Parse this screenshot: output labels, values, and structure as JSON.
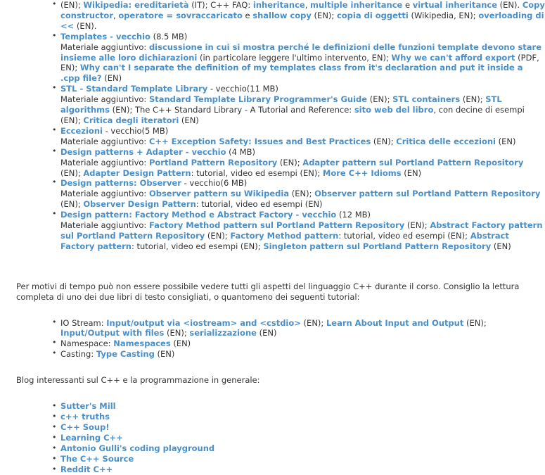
{
  "colors": {
    "link": "#4a8fc7",
    "text": "#333333",
    "background": "#ffffff"
  },
  "sections": {
    "materials_list": {
      "continued_first_entry": {
        "line_prefix": "(EN); ",
        "parts": [
          {
            "t": "link",
            "v": "Wikipedia: ereditarietà"
          },
          {
            "t": "text",
            "v": " (IT); C++ FAQ: "
          },
          {
            "t": "link",
            "v": "inheritance"
          },
          {
            "t": "text",
            "v": ", "
          },
          {
            "t": "link",
            "v": "multiple inheritance"
          },
          {
            "t": "text",
            "v": " e "
          },
          {
            "t": "link",
            "v": "virtual inheritance"
          },
          {
            "t": "text",
            "v": " (EN). "
          },
          {
            "t": "link",
            "v": "Copy constructor"
          },
          {
            "t": "text",
            "v": ", "
          },
          {
            "t": "link",
            "v": "operatore = sovraccaricato"
          },
          {
            "t": "text",
            "v": " e "
          },
          {
            "t": "link",
            "v": "shallow copy"
          },
          {
            "t": "text",
            "v": " (EN); "
          },
          {
            "t": "link",
            "v": "copia di oggetti"
          },
          {
            "t": "text",
            "v": " (Wikipedia, EN); "
          },
          {
            "t": "link",
            "v": "overloading di <<"
          },
          {
            "t": "text",
            "v": " (EN)."
          }
        ]
      },
      "items": [
        {
          "title_link": "Templates - vecchio",
          "title_suffix": " (8.5 MB)",
          "material_label": "Materiale aggiuntivo: ",
          "material_parts": [
            {
              "t": "link",
              "v": "discussione in cui si mostra perché le definizioni delle funzioni template devono stare insieme alle loro dichiarazioni"
            },
            {
              "t": "text",
              "v": " (in particolare leggere l'ultimo intervento, EN); "
            },
            {
              "t": "link",
              "v": "Why we can't afford export"
            },
            {
              "t": "text",
              "v": " (PDF, EN); "
            },
            {
              "t": "link",
              "v": "Why can't I separate the definition of my templates class from it's declaration and put it inside a .cpp file?"
            },
            {
              "t": "text",
              "v": " (EN)"
            }
          ]
        },
        {
          "title_link": "STL - Standard Template Library",
          "title_suffix": " - vecchio(11 MB)",
          "material_label": "Materiale aggiuntivo: ",
          "material_parts": [
            {
              "t": "link",
              "v": "Standard Template Library Programmer's Guide"
            },
            {
              "t": "text",
              "v": " (EN); "
            },
            {
              "t": "link",
              "v": "STL containers"
            },
            {
              "t": "text",
              "v": " (EN); "
            },
            {
              "t": "link",
              "v": "STL algorithms"
            },
            {
              "t": "text",
              "v": " (EN); The C++ Standard Library - A Tutorial and Reference: "
            },
            {
              "t": "link",
              "v": "sito web del libro"
            },
            {
              "t": "text",
              "v": ", con decine di esempi (EN); "
            },
            {
              "t": "link",
              "v": "Critica degli iteratori"
            },
            {
              "t": "text",
              "v": " (EN)"
            }
          ]
        },
        {
          "title_link": "Eccezioni",
          "title_suffix": " - vecchio(5 MB)",
          "material_label": "Materiale aggiuntivo: ",
          "material_parts": [
            {
              "t": "link",
              "v": "C++ Exception Safety: Issues and Best Practices"
            },
            {
              "t": "text",
              "v": " (EN); "
            },
            {
              "t": "link",
              "v": "Critica delle eccezioni"
            },
            {
              "t": "text",
              "v": " (EN)"
            }
          ]
        },
        {
          "title_link": "Design patterns + Adapter - vecchio",
          "title_suffix": " (4 MB)",
          "material_label": "Materiale aggiuntivo: ",
          "material_parts": [
            {
              "t": "link",
              "v": "Portland Pattern Repository"
            },
            {
              "t": "text",
              "v": " (EN); "
            },
            {
              "t": "link",
              "v": "Adapter pattern sul Portland Pattern Repository"
            },
            {
              "t": "text",
              "v": " (EN); "
            },
            {
              "t": "link",
              "v": "Adapter Design Pattern"
            },
            {
              "t": "text",
              "v": ": tutorial, video ed esempi (EN); "
            },
            {
              "t": "link",
              "v": "More C++ Idioms"
            },
            {
              "t": "text",
              "v": " (EN)"
            }
          ]
        },
        {
          "title_link": "Design patterns: Observer",
          "title_suffix": " - vecchio(6 MB)",
          "material_label": "Materiale aggiuntivo: ",
          "material_parts": [
            {
              "t": "link",
              "v": "Observer pattern su Wikipedia"
            },
            {
              "t": "text",
              "v": " (EN); "
            },
            {
              "t": "link",
              "v": "Observer pattern sul Portland Pattern Repository"
            },
            {
              "t": "text",
              "v": " (EN); "
            },
            {
              "t": "link",
              "v": "Observer Design Pattern"
            },
            {
              "t": "text",
              "v": ": tutorial, video ed esempi (EN)"
            }
          ]
        },
        {
          "title_link": "Design pattern: Factory Method e Abstract Factory - vecchio",
          "title_suffix": " (12 MB)",
          "material_label": "Materiale aggiuntivo: ",
          "material_parts": [
            {
              "t": "link",
              "v": "Factory Method pattern sul Portland Pattern Repository"
            },
            {
              "t": "text",
              "v": " (EN); "
            },
            {
              "t": "link",
              "v": "Abstract Factory pattern sul Portland Pattern Repository"
            },
            {
              "t": "text",
              "v": " (EN); "
            },
            {
              "t": "link",
              "v": "Factory Method pattern"
            },
            {
              "t": "text",
              "v": ": tutorial, video ed esempi (EN); "
            },
            {
              "t": "link",
              "v": "Abstract Factory pattern"
            },
            {
              "t": "text",
              "v": ": tutorial, video ed esempi (EN); "
            },
            {
              "t": "link",
              "v": "Singleton pattern sul Portland Pattern Repository"
            },
            {
              "t": "text",
              "v": " (EN)"
            }
          ]
        }
      ]
    },
    "tutorial_intro": {
      "paragraph": "Per motivi di tempo può non essere possibile vedere tutti gli aspetti del linguaggio C++ durante il corso. Consiglio la lettura completa di uno dei due libri di testo consigliati, o quantomeno dei seguenti tutorial:"
    },
    "tutorial_list": {
      "items": [
        {
          "parts": [
            {
              "t": "text",
              "v": "IO Stream: "
            },
            {
              "t": "link",
              "v": "Input/output via <iostream> and <cstdio>"
            },
            {
              "t": "text",
              "v": " (EN); "
            },
            {
              "t": "link",
              "v": "Learn About Input and Output"
            },
            {
              "t": "text",
              "v": " (EN); "
            },
            {
              "t": "link",
              "v": "Input/Output with files"
            },
            {
              "t": "text",
              "v": " (EN); "
            },
            {
              "t": "link",
              "v": "serializzazione"
            },
            {
              "t": "text",
              "v": " (EN)"
            }
          ]
        },
        {
          "parts": [
            {
              "t": "text",
              "v": "Namespace: "
            },
            {
              "t": "link",
              "v": "Namespaces"
            },
            {
              "t": "text",
              "v": " (EN)"
            }
          ]
        },
        {
          "parts": [
            {
              "t": "text",
              "v": "Casting: "
            },
            {
              "t": "link",
              "v": "Type Casting"
            },
            {
              "t": "text",
              "v": " (EN)"
            }
          ]
        }
      ]
    },
    "blogs_intro": {
      "paragraph": "Blog interessanti sul C++ e la programmazione in generale:"
    },
    "blogs_list": {
      "items": [
        "Sutter's Mill",
        "c++ truths",
        "C++ Soup!",
        "Learning C++",
        "Antonio Gulli's coding playground",
        "The C++ Source",
        "Reddit C++"
      ]
    }
  }
}
